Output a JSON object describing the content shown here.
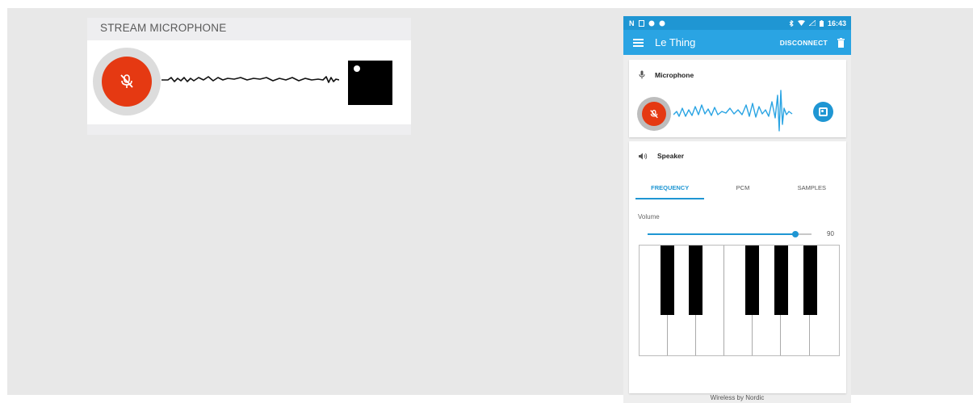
{
  "stream": {
    "header": "STREAM MICROPHONE"
  },
  "phone": {
    "status": {
      "left_icons": "N",
      "time": "16:43"
    },
    "appbar": {
      "title": "Le Thing",
      "action": "DISCONNECT"
    },
    "mic_card": {
      "title": "Microphone"
    },
    "speaker_card": {
      "title": "Speaker",
      "tabs": [
        "FREQUENCY",
        "PCM",
        "SAMPLES"
      ],
      "active_tab": "FREQUENCY",
      "volume_label": "Volume",
      "volume_value": "90",
      "volume_fraction": 0.9
    },
    "footer": "Wireless by Nordic"
  },
  "colors": {
    "accent_blue": "#1f96d3",
    "mic_red": "#e53912"
  },
  "icons": {
    "menu": "menu-icon",
    "trash": "trash-icon",
    "mic_off": "mic-off-icon",
    "stop": "stop-icon",
    "speaker": "speaker-icon",
    "microphone": "microphone-icon"
  }
}
